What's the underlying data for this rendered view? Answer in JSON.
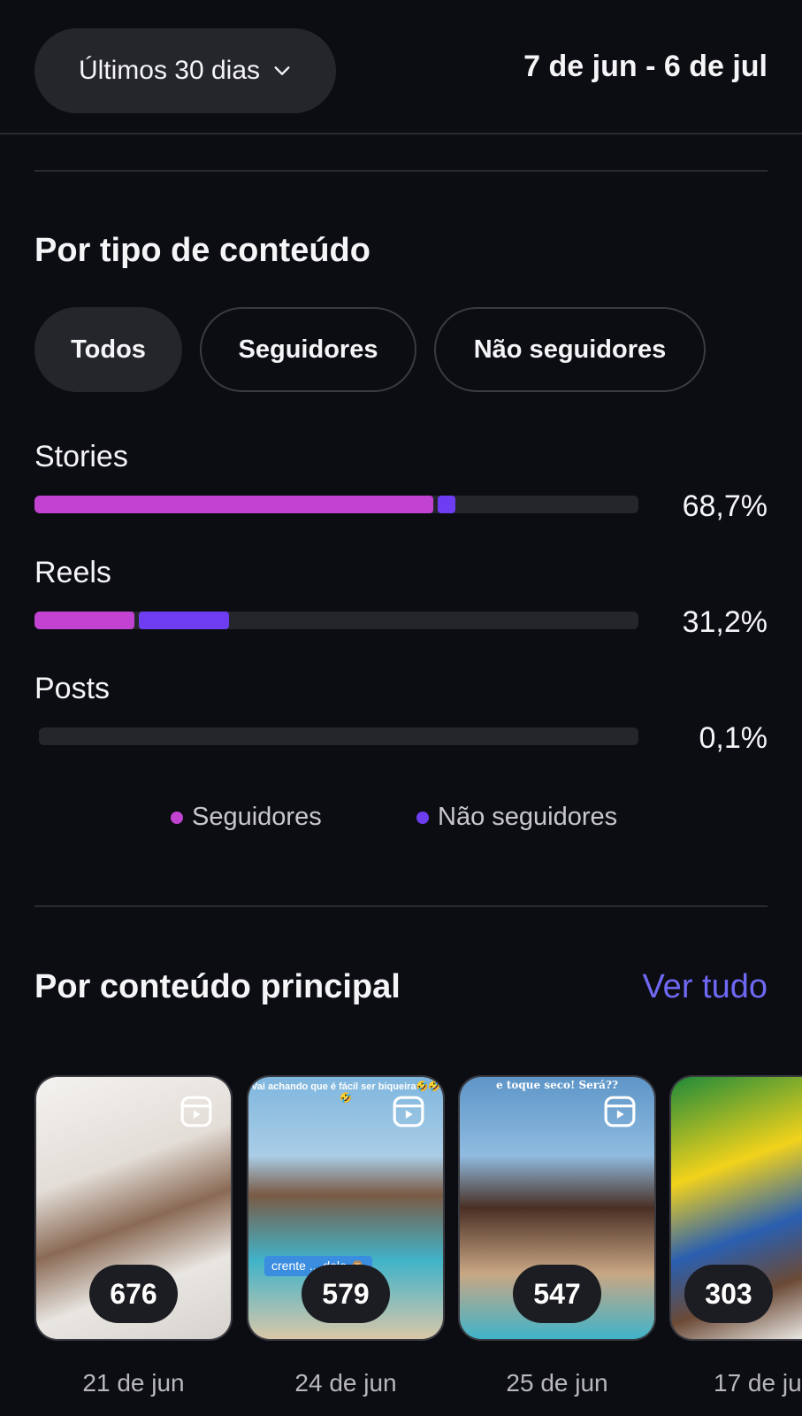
{
  "header": {
    "range_label": "Últimos 30 dias",
    "date_range": "7 de jun - 6 de jul"
  },
  "content_type": {
    "title": "Por tipo de conteúdo",
    "filters": [
      "Todos",
      "Seguidores",
      "Não seguidores"
    ],
    "active_filter": "Todos",
    "rows": [
      {
        "label": "Stories",
        "percent": "68,7%",
        "followers_fraction": 0.66,
        "nonfollowers_fraction": 0.03
      },
      {
        "label": "Reels",
        "percent": "31,2%",
        "followers_fraction": 0.165,
        "nonfollowers_fraction": 0.15
      },
      {
        "label": "Posts",
        "percent": "0,1%",
        "followers_fraction": 0.0,
        "nonfollowers_fraction": 0.0
      }
    ],
    "legend": {
      "followers": "Seguidores",
      "nonfollowers": "Não seguidores"
    },
    "colors": {
      "followers": "#c243d2",
      "nonfollowers": "#6e3df2"
    }
  },
  "top_content": {
    "title": "Por conteúdo principal",
    "see_all": "Ver tudo",
    "items": [
      {
        "count": "676",
        "date": "21 de jun"
      },
      {
        "count": "579",
        "date": "24 de jun",
        "caption": "crente ... delo 🙈",
        "top_text": "Vai achando que é fácil ser biqueira🤣🤣🤣"
      },
      {
        "count": "547",
        "date": "25 de jun",
        "top_text": "e toque seco! Será??"
      },
      {
        "count": "303",
        "date": "17 de ju"
      }
    ]
  }
}
